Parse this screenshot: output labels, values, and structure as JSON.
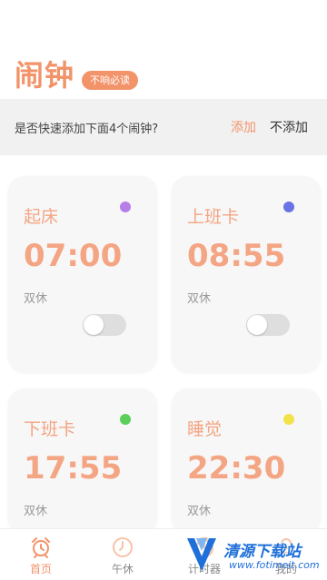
{
  "app": {
    "title": "闹钟",
    "badge": "不响必读"
  },
  "quick_add": {
    "prompt": "是否快速添加下面4个闹钟?",
    "add_label": "添加",
    "decline_label": "不添加"
  },
  "alarms": [
    {
      "name": "起床",
      "time": "07:00",
      "repeat": "双休",
      "dot_color": "#b77ee8",
      "enabled": false
    },
    {
      "name": "上班卡",
      "time": "08:55",
      "repeat": "双休",
      "dot_color": "#6a73e6",
      "enabled": false
    },
    {
      "name": "下班卡",
      "time": "17:55",
      "repeat": "双休",
      "dot_color": "#5ccf5a",
      "enabled": false
    },
    {
      "name": "睡觉",
      "time": "22:30",
      "repeat": "双休",
      "dot_color": "#f2e24a",
      "enabled": false
    }
  ],
  "tabs": [
    {
      "label": "首页",
      "icon": "alarm-clock-icon",
      "active": true
    },
    {
      "label": "午休",
      "icon": "clock-icon",
      "active": false
    },
    {
      "label": "计时器",
      "icon": "timer-icon",
      "active": false
    },
    {
      "label": "我的",
      "icon": "user-icon",
      "active": false
    }
  ],
  "watermark": {
    "text": "清源下载站",
    "url": "www.fotimeit.com"
  },
  "colors": {
    "accent": "#f2936a",
    "card_text": "#f4a583",
    "card_bg": "#f7f7f7"
  }
}
